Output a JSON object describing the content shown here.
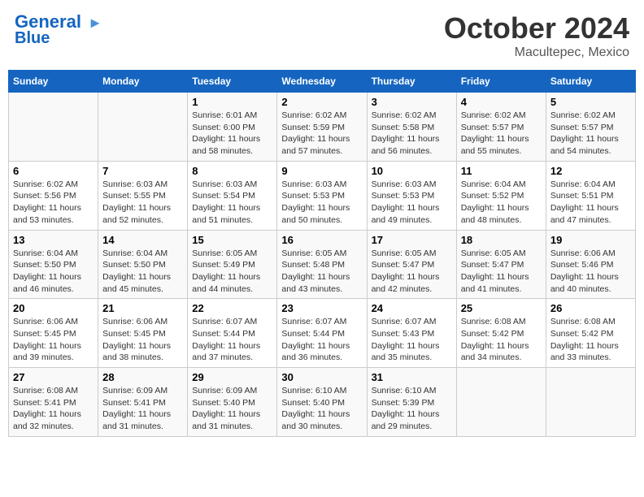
{
  "header": {
    "logo": {
      "line1": "General",
      "line2": "Blue"
    },
    "month": "October 2024",
    "location": "Macultepec, Mexico"
  },
  "weekdays": [
    "Sunday",
    "Monday",
    "Tuesday",
    "Wednesday",
    "Thursday",
    "Friday",
    "Saturday"
  ],
  "weeks": [
    [
      {
        "day": "",
        "sunrise": "",
        "sunset": "",
        "daylight": ""
      },
      {
        "day": "",
        "sunrise": "",
        "sunset": "",
        "daylight": ""
      },
      {
        "day": "1",
        "sunrise": "Sunrise: 6:01 AM",
        "sunset": "Sunset: 6:00 PM",
        "daylight": "Daylight: 11 hours and 58 minutes."
      },
      {
        "day": "2",
        "sunrise": "Sunrise: 6:02 AM",
        "sunset": "Sunset: 5:59 PM",
        "daylight": "Daylight: 11 hours and 57 minutes."
      },
      {
        "day": "3",
        "sunrise": "Sunrise: 6:02 AM",
        "sunset": "Sunset: 5:58 PM",
        "daylight": "Daylight: 11 hours and 56 minutes."
      },
      {
        "day": "4",
        "sunrise": "Sunrise: 6:02 AM",
        "sunset": "Sunset: 5:57 PM",
        "daylight": "Daylight: 11 hours and 55 minutes."
      },
      {
        "day": "5",
        "sunrise": "Sunrise: 6:02 AM",
        "sunset": "Sunset: 5:57 PM",
        "daylight": "Daylight: 11 hours and 54 minutes."
      }
    ],
    [
      {
        "day": "6",
        "sunrise": "Sunrise: 6:02 AM",
        "sunset": "Sunset: 5:56 PM",
        "daylight": "Daylight: 11 hours and 53 minutes."
      },
      {
        "day": "7",
        "sunrise": "Sunrise: 6:03 AM",
        "sunset": "Sunset: 5:55 PM",
        "daylight": "Daylight: 11 hours and 52 minutes."
      },
      {
        "day": "8",
        "sunrise": "Sunrise: 6:03 AM",
        "sunset": "Sunset: 5:54 PM",
        "daylight": "Daylight: 11 hours and 51 minutes."
      },
      {
        "day": "9",
        "sunrise": "Sunrise: 6:03 AM",
        "sunset": "Sunset: 5:53 PM",
        "daylight": "Daylight: 11 hours and 50 minutes."
      },
      {
        "day": "10",
        "sunrise": "Sunrise: 6:03 AM",
        "sunset": "Sunset: 5:53 PM",
        "daylight": "Daylight: 11 hours and 49 minutes."
      },
      {
        "day": "11",
        "sunrise": "Sunrise: 6:04 AM",
        "sunset": "Sunset: 5:52 PM",
        "daylight": "Daylight: 11 hours and 48 minutes."
      },
      {
        "day": "12",
        "sunrise": "Sunrise: 6:04 AM",
        "sunset": "Sunset: 5:51 PM",
        "daylight": "Daylight: 11 hours and 47 minutes."
      }
    ],
    [
      {
        "day": "13",
        "sunrise": "Sunrise: 6:04 AM",
        "sunset": "Sunset: 5:50 PM",
        "daylight": "Daylight: 11 hours and 46 minutes."
      },
      {
        "day": "14",
        "sunrise": "Sunrise: 6:04 AM",
        "sunset": "Sunset: 5:50 PM",
        "daylight": "Daylight: 11 hours and 45 minutes."
      },
      {
        "day": "15",
        "sunrise": "Sunrise: 6:05 AM",
        "sunset": "Sunset: 5:49 PM",
        "daylight": "Daylight: 11 hours and 44 minutes."
      },
      {
        "day": "16",
        "sunrise": "Sunrise: 6:05 AM",
        "sunset": "Sunset: 5:48 PM",
        "daylight": "Daylight: 11 hours and 43 minutes."
      },
      {
        "day": "17",
        "sunrise": "Sunrise: 6:05 AM",
        "sunset": "Sunset: 5:47 PM",
        "daylight": "Daylight: 11 hours and 42 minutes."
      },
      {
        "day": "18",
        "sunrise": "Sunrise: 6:05 AM",
        "sunset": "Sunset: 5:47 PM",
        "daylight": "Daylight: 11 hours and 41 minutes."
      },
      {
        "day": "19",
        "sunrise": "Sunrise: 6:06 AM",
        "sunset": "Sunset: 5:46 PM",
        "daylight": "Daylight: 11 hours and 40 minutes."
      }
    ],
    [
      {
        "day": "20",
        "sunrise": "Sunrise: 6:06 AM",
        "sunset": "Sunset: 5:45 PM",
        "daylight": "Daylight: 11 hours and 39 minutes."
      },
      {
        "day": "21",
        "sunrise": "Sunrise: 6:06 AM",
        "sunset": "Sunset: 5:45 PM",
        "daylight": "Daylight: 11 hours and 38 minutes."
      },
      {
        "day": "22",
        "sunrise": "Sunrise: 6:07 AM",
        "sunset": "Sunset: 5:44 PM",
        "daylight": "Daylight: 11 hours and 37 minutes."
      },
      {
        "day": "23",
        "sunrise": "Sunrise: 6:07 AM",
        "sunset": "Sunset: 5:44 PM",
        "daylight": "Daylight: 11 hours and 36 minutes."
      },
      {
        "day": "24",
        "sunrise": "Sunrise: 6:07 AM",
        "sunset": "Sunset: 5:43 PM",
        "daylight": "Daylight: 11 hours and 35 minutes."
      },
      {
        "day": "25",
        "sunrise": "Sunrise: 6:08 AM",
        "sunset": "Sunset: 5:42 PM",
        "daylight": "Daylight: 11 hours and 34 minutes."
      },
      {
        "day": "26",
        "sunrise": "Sunrise: 6:08 AM",
        "sunset": "Sunset: 5:42 PM",
        "daylight": "Daylight: 11 hours and 33 minutes."
      }
    ],
    [
      {
        "day": "27",
        "sunrise": "Sunrise: 6:08 AM",
        "sunset": "Sunset: 5:41 PM",
        "daylight": "Daylight: 11 hours and 32 minutes."
      },
      {
        "day": "28",
        "sunrise": "Sunrise: 6:09 AM",
        "sunset": "Sunset: 5:41 PM",
        "daylight": "Daylight: 11 hours and 31 minutes."
      },
      {
        "day": "29",
        "sunrise": "Sunrise: 6:09 AM",
        "sunset": "Sunset: 5:40 PM",
        "daylight": "Daylight: 11 hours and 31 minutes."
      },
      {
        "day": "30",
        "sunrise": "Sunrise: 6:10 AM",
        "sunset": "Sunset: 5:40 PM",
        "daylight": "Daylight: 11 hours and 30 minutes."
      },
      {
        "day": "31",
        "sunrise": "Sunrise: 6:10 AM",
        "sunset": "Sunset: 5:39 PM",
        "daylight": "Daylight: 11 hours and 29 minutes."
      },
      {
        "day": "",
        "sunrise": "",
        "sunset": "",
        "daylight": ""
      },
      {
        "day": "",
        "sunrise": "",
        "sunset": "",
        "daylight": ""
      }
    ]
  ]
}
